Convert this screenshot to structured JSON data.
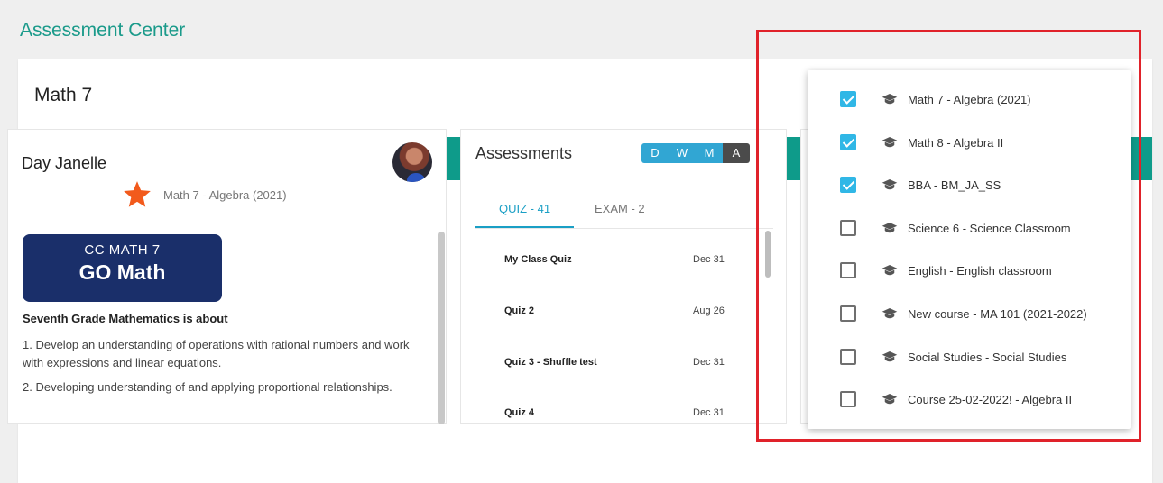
{
  "app": {
    "title": "Assessment Center"
  },
  "course": {
    "title": "Math 7",
    "nav_icons": [
      "home-icon",
      "question-icon",
      "alert-icon",
      "bar-chart-icon",
      "exit-door-icon"
    ]
  },
  "teacher": {
    "name": "Day Janelle",
    "course_label": "Math 7 - Algebra (2021)",
    "banner_line1": "CC MATH 7",
    "banner_line2": "GO Math",
    "description_heading": "Seventh Grade Mathematics is about",
    "description_items": [
      "1. Develop an understanding of operations with rational numbers and work with expressions and linear equations.",
      "2. Developing understanding of and applying proportional relationships."
    ]
  },
  "assessments": {
    "title": "Assessments",
    "ranges": [
      "D",
      "W",
      "M",
      "A"
    ],
    "active_range": "A",
    "tabs": [
      {
        "label": "QUIZ - 41",
        "active": true
      },
      {
        "label": "EXAM - 2",
        "active": false
      }
    ],
    "items": [
      {
        "name": "My Class Quiz",
        "date": "Dec 31"
      },
      {
        "name": "Quiz 2",
        "date": "Aug 26"
      },
      {
        "name": "Quiz 3 - Shuffle test",
        "date": "Dec 31"
      },
      {
        "name": "Quiz 4",
        "date": "Dec 31"
      }
    ]
  },
  "course_dropdown": {
    "items": [
      {
        "label": "Math 7 - Algebra (2021)",
        "checked": true
      },
      {
        "label": "Math 8 - Algebra II",
        "checked": true
      },
      {
        "label": "BBA - BM_JA_SS",
        "checked": true
      },
      {
        "label": "Science 6 - Science Classroom",
        "checked": false
      },
      {
        "label": "English - English classroom",
        "checked": false
      },
      {
        "label": "New course - MA 101 (2021-2022)",
        "checked": false
      },
      {
        "label": "Social Studies - Social Studies",
        "checked": false
      },
      {
        "label": "Course 25-02-2022! - Algebra II",
        "checked": false
      }
    ]
  },
  "colors": {
    "accent_teal": "#0e9b8a",
    "title_teal": "#1a9a8a",
    "range_blue": "#31a6d3",
    "checkbox_blue": "#30b7e6",
    "highlight_red": "#e0222a",
    "banner_navy": "#1a2f6a"
  }
}
